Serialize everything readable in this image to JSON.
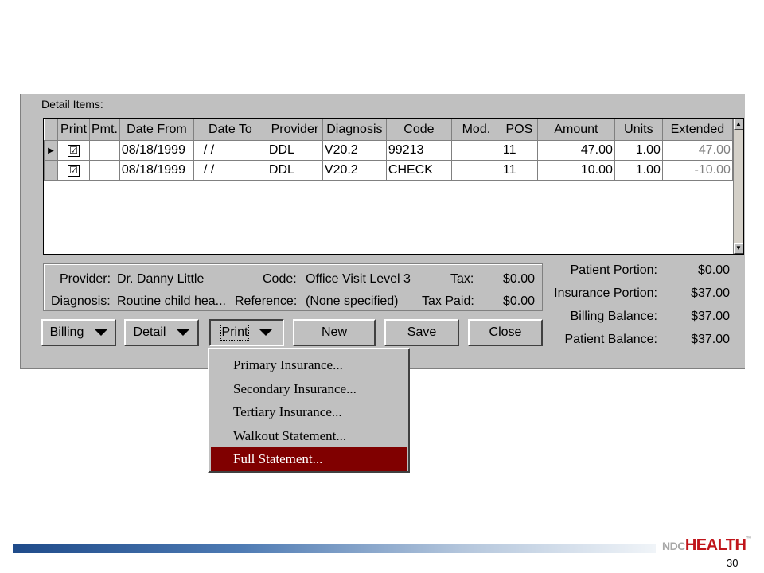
{
  "detail_label": "Detail Items:",
  "columns": [
    "Print",
    "Pmt.",
    "Date From",
    "Date To",
    "Provider",
    "Diagnosis",
    "Code",
    "Mod.",
    "POS",
    "Amount",
    "Units",
    "Extended"
  ],
  "rows": [
    {
      "print": "☑",
      "pmt": "",
      "date_from": "08/18/1999",
      "date_to": "/ /",
      "provider": "DDL",
      "diagnosis": "V20.2",
      "code": "99213",
      "mod": "",
      "pos": "11",
      "amount": "47.00",
      "units": "1.00",
      "extended": "47.00"
    },
    {
      "print": "☑",
      "pmt": "",
      "date_from": "08/18/1999",
      "date_to": "/ /",
      "provider": "DDL",
      "diagnosis": "V20.2",
      "code": "CHECK",
      "mod": "",
      "pos": "11",
      "amount": "10.00",
      "units": "1.00",
      "extended": "-10.00"
    }
  ],
  "info": {
    "provider_label": "Provider:",
    "provider_value": "Dr. Danny Little",
    "diagnosis_label": "Diagnosis:",
    "diagnosis_value": "Routine child hea...",
    "code_label": "Code:",
    "code_value": "Office Visit Level 3",
    "reference_label": "Reference:",
    "reference_value": "(None specified)",
    "tax_label": "Tax:",
    "tax_value": "$0.00",
    "tax_paid_label": "Tax Paid:",
    "tax_paid_value": "$0.00"
  },
  "summary": {
    "patient_portion_label": "Patient Portion:",
    "patient_portion_value": "$0.00",
    "insurance_portion_label": "Insurance Portion:",
    "insurance_portion_value": "$37.00",
    "billing_balance_label": "Billing Balance:",
    "billing_balance_value": "$37.00",
    "patient_balance_label": "Patient Balance:",
    "patient_balance_value": "$37.00"
  },
  "buttons": {
    "billing": "Billing",
    "detail": "Detail",
    "print": "Print",
    "new": "New",
    "save": "Save",
    "close": "Close"
  },
  "menu": [
    "Primary Insurance...",
    "Secondary Insurance...",
    "Tertiary Insurance...",
    "Walkout Statement...",
    "Full Statement..."
  ],
  "menu_highlight_color": "#800000",
  "logo": {
    "prefix": "NDC",
    "main": "HEALTH",
    "tm": "™"
  },
  "page_number": "30"
}
